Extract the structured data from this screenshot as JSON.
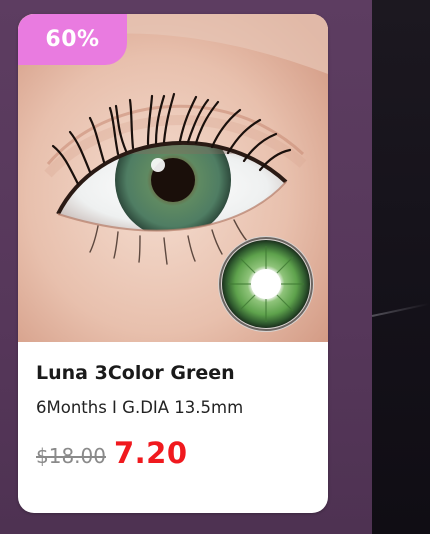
{
  "product_card": {
    "discount_badge": "60%",
    "name": "Luna 3Color Green",
    "spec": "6Months I G.DIA 13.5mm",
    "original_price": "$18.00",
    "sale_price": "7.20",
    "image_icon": "eye-with-green-lens-image"
  },
  "colors": {
    "badge_background": "#e97be0",
    "sale_price": "#f0191e",
    "original_price": "#8a8a8a",
    "page_background": "#5a3b5e",
    "card_background": "#ffffff"
  }
}
